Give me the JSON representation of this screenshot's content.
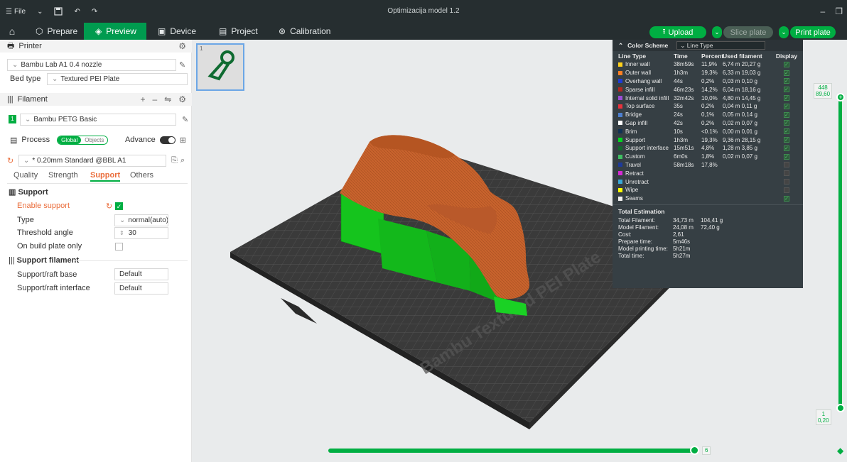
{
  "titlebar": {
    "file_label": "File",
    "title": "Optimizacija model 1.2"
  },
  "tabs": [
    {
      "label": "Prepare",
      "icon": "cube-icon"
    },
    {
      "label": "Preview",
      "icon": "layers-icon"
    },
    {
      "label": "Device",
      "icon": "device-icon"
    },
    {
      "label": "Project",
      "icon": "project-icon"
    },
    {
      "label": "Calibration",
      "icon": "calibration-icon"
    }
  ],
  "actions": {
    "upload": "Upload",
    "slice_plate": "Slice plate",
    "print_plate": "Print plate"
  },
  "printer": {
    "section_title": "Printer",
    "printer_name": "Bambu Lab A1 0.4 nozzle",
    "bed_type_label": "Bed type",
    "bed_type_value": "Textured PEI Plate"
  },
  "filament": {
    "section_title": "Filament",
    "slot": "1",
    "name": "Bambu PETG Basic"
  },
  "process": {
    "section_title": "Process",
    "global_label": "Global",
    "objects_label": "Objects",
    "advance_label": "Advance",
    "profile": "* 0.20mm Standard @BBL A1",
    "subtabs": [
      "Quality",
      "Strength",
      "Support",
      "Others"
    ]
  },
  "support": {
    "section_title": "Support",
    "enable_label": "Enable support",
    "type_label": "Type",
    "type_value": "normal(auto)",
    "threshold_label": "Threshold angle",
    "threshold_value": "30",
    "build_plate_label": "On build plate only",
    "filament_section": "Support filament",
    "raft_base_label": "Support/raft base",
    "raft_base_value": "Default",
    "raft_interface_label": "Support/raft interface",
    "raft_interface_value": "Default"
  },
  "plate_text": "Bambu Textured PEI Plate",
  "legend": {
    "color_scheme_label": "Color Scheme",
    "scheme_value": "Line Type",
    "columns": [
      "Line Type",
      "Time",
      "Percent",
      "Used filament",
      "Display"
    ],
    "rows": [
      {
        "name": "Inner wall",
        "color": "#ffd11a",
        "time": "38m59s",
        "percent": "11,9%",
        "used": "6,74 m  20,27 g",
        "display": true
      },
      {
        "name": "Outer wall",
        "color": "#ff7f24",
        "time": "1h3m",
        "percent": "19,3%",
        "used": "6,33 m  19,03 g",
        "display": true
      },
      {
        "name": "Overhang wall",
        "color": "#1f3bd6",
        "time": "44s",
        "percent": "0,2%",
        "used": "0,03 m  0,10 g",
        "display": true
      },
      {
        "name": "Sparse infill",
        "color": "#b3261e",
        "time": "46m23s",
        "percent": "14,2%",
        "used": "6,04 m  18,16 g",
        "display": true
      },
      {
        "name": "Internal solid infill",
        "color": "#9b4dd6",
        "time": "32m42s",
        "percent": "10,0%",
        "used": "4,80 m  14,45 g",
        "display": true
      },
      {
        "name": "Top surface",
        "color": "#e8323c",
        "time": "35s",
        "percent": "0,2%",
        "used": "0,04 m  0,11 g",
        "display": true
      },
      {
        "name": "Bridge",
        "color": "#4d7fcf",
        "time": "24s",
        "percent": "0,1%",
        "used": "0,05 m  0,14 g",
        "display": true
      },
      {
        "name": "Gap infill",
        "color": "#ffffff",
        "time": "42s",
        "percent": "0,2%",
        "used": "0,02 m  0,07 g",
        "display": true
      },
      {
        "name": "Brim",
        "color": "#113255",
        "time": "10s",
        "percent": "<0.1%",
        "used": "0,00 m  0,01 g",
        "display": true
      },
      {
        "name": "Support",
        "color": "#00d61f",
        "time": "1h3m",
        "percent": "19,3%",
        "used": "9,36 m  28,15 g",
        "display": true
      },
      {
        "name": "Support interface",
        "color": "#126b2b",
        "time": "15m51s",
        "percent": "4,8%",
        "used": "1,28 m  3,85 g",
        "display": true
      },
      {
        "name": "Custom",
        "color": "#3fbf62",
        "time": "6m0s",
        "percent": "1,8%",
        "used": "0,02 m  0,07 g",
        "display": true
      },
      {
        "name": "Travel",
        "color": "#1d3a9a",
        "time": "58m18s",
        "percent": "17,8%",
        "used": "",
        "display": false
      },
      {
        "name": "Retract",
        "color": "#d62ad6",
        "time": "",
        "percent": "",
        "used": "",
        "display": false
      },
      {
        "name": "Unretract",
        "color": "#38a8d6",
        "time": "",
        "percent": "",
        "used": "",
        "display": false
      },
      {
        "name": "Wipe",
        "color": "#ffff00",
        "time": "",
        "percent": "",
        "used": "",
        "display": false
      },
      {
        "name": "Seams",
        "color": "#f0f0f0",
        "time": "",
        "percent": "",
        "used": "",
        "display": true
      }
    ],
    "total_title": "Total Estimation",
    "totals": [
      {
        "label": "Total Filament:",
        "v1": "34,73 m",
        "v2": "104,41 g"
      },
      {
        "label": "Model Filament:",
        "v1": "24,08 m",
        "v2": "72,40 g"
      },
      {
        "label": "Cost:",
        "v1": "2,61",
        "v2": ""
      },
      {
        "label": "Prepare time:",
        "v1": "5m46s",
        "v2": ""
      },
      {
        "label": "Model printing time:",
        "v1": "5h21m",
        "v2": ""
      },
      {
        "label": "Total time:",
        "v1": "5h27m",
        "v2": ""
      }
    ]
  },
  "layer_slider": {
    "top_layer": "448",
    "top_height": "89,60",
    "bottom_layer": "1",
    "bottom_height": "0,20"
  },
  "move_slider": {
    "value": "6"
  },
  "colors": {
    "accent": "#00ae42",
    "model_orange": "#c8632d",
    "support_green": "#11c21a"
  }
}
